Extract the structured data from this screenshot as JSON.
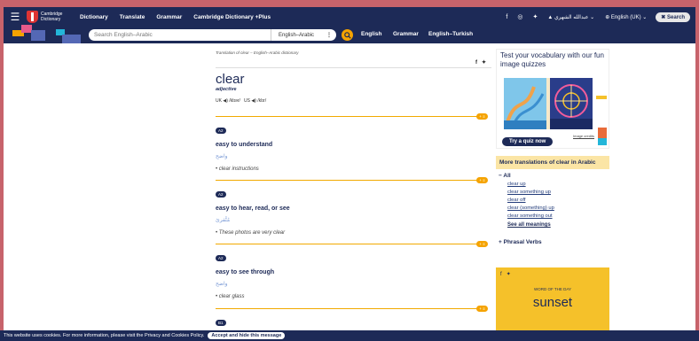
{
  "nav": {
    "logo_line1": "Cambridge",
    "logo_line2": "Dictionary",
    "links": [
      "Dictionary",
      "Translate",
      "Grammar",
      "Cambridge Dictionary +Plus"
    ],
    "user_name": "عبدالله الشهري",
    "language": "English (UK)",
    "search_label": "Search"
  },
  "search": {
    "placeholder": "Search English–Arabic",
    "dictionary": "English–Arabic",
    "sub_links": [
      "English",
      "Grammar",
      "English–Turkish"
    ]
  },
  "entry": {
    "breadcrumb": "Translation of clear – English–Arabic dictionary",
    "headword": "clear",
    "pos": "adjective",
    "pron_uk_label": "UK",
    "pron_uk": "/klɪər/",
    "pron_us_label": "US",
    "pron_us": "/klɪr/",
    "plus_label": "+ ≡",
    "senses": [
      {
        "level": "A2",
        "definition": "easy to understand",
        "translation": "واضح",
        "example": "• clear instructions"
      },
      {
        "level": "A2",
        "definition": "easy to hear, read, or see",
        "translation": "مُتَّقرئ",
        "example": "• These photos are very clear"
      },
      {
        "level": "A2",
        "definition": "easy to see through",
        "translation": "واضح",
        "example": "• clear glass"
      },
      {
        "level": "B1",
        "definition": "",
        "translation": "",
        "example": ""
      }
    ]
  },
  "quiz": {
    "title": "Test your vocabulary with our fun image quizzes",
    "button": "Try a quiz now",
    "credits": "Image credits"
  },
  "more_translations": {
    "heading": "More translations of clear in Arabic",
    "all_label": "All",
    "items": [
      "clear up",
      "clear something up",
      "clear off",
      "clear (something) up",
      "clear something out"
    ],
    "see_all": "See all meanings",
    "phrasal": "Phrasal Verbs"
  },
  "wotd": {
    "label": "WORD OF THE DAY",
    "word": "sunset"
  },
  "cookie": {
    "text": "This website uses cookies. For more information, please visit the Privacy and Cookies Policy.",
    "accept": "Accept and hide this message"
  },
  "colors": {
    "navy": "#1d2a57",
    "accent": "#f5a300",
    "background": "#c7636b"
  }
}
